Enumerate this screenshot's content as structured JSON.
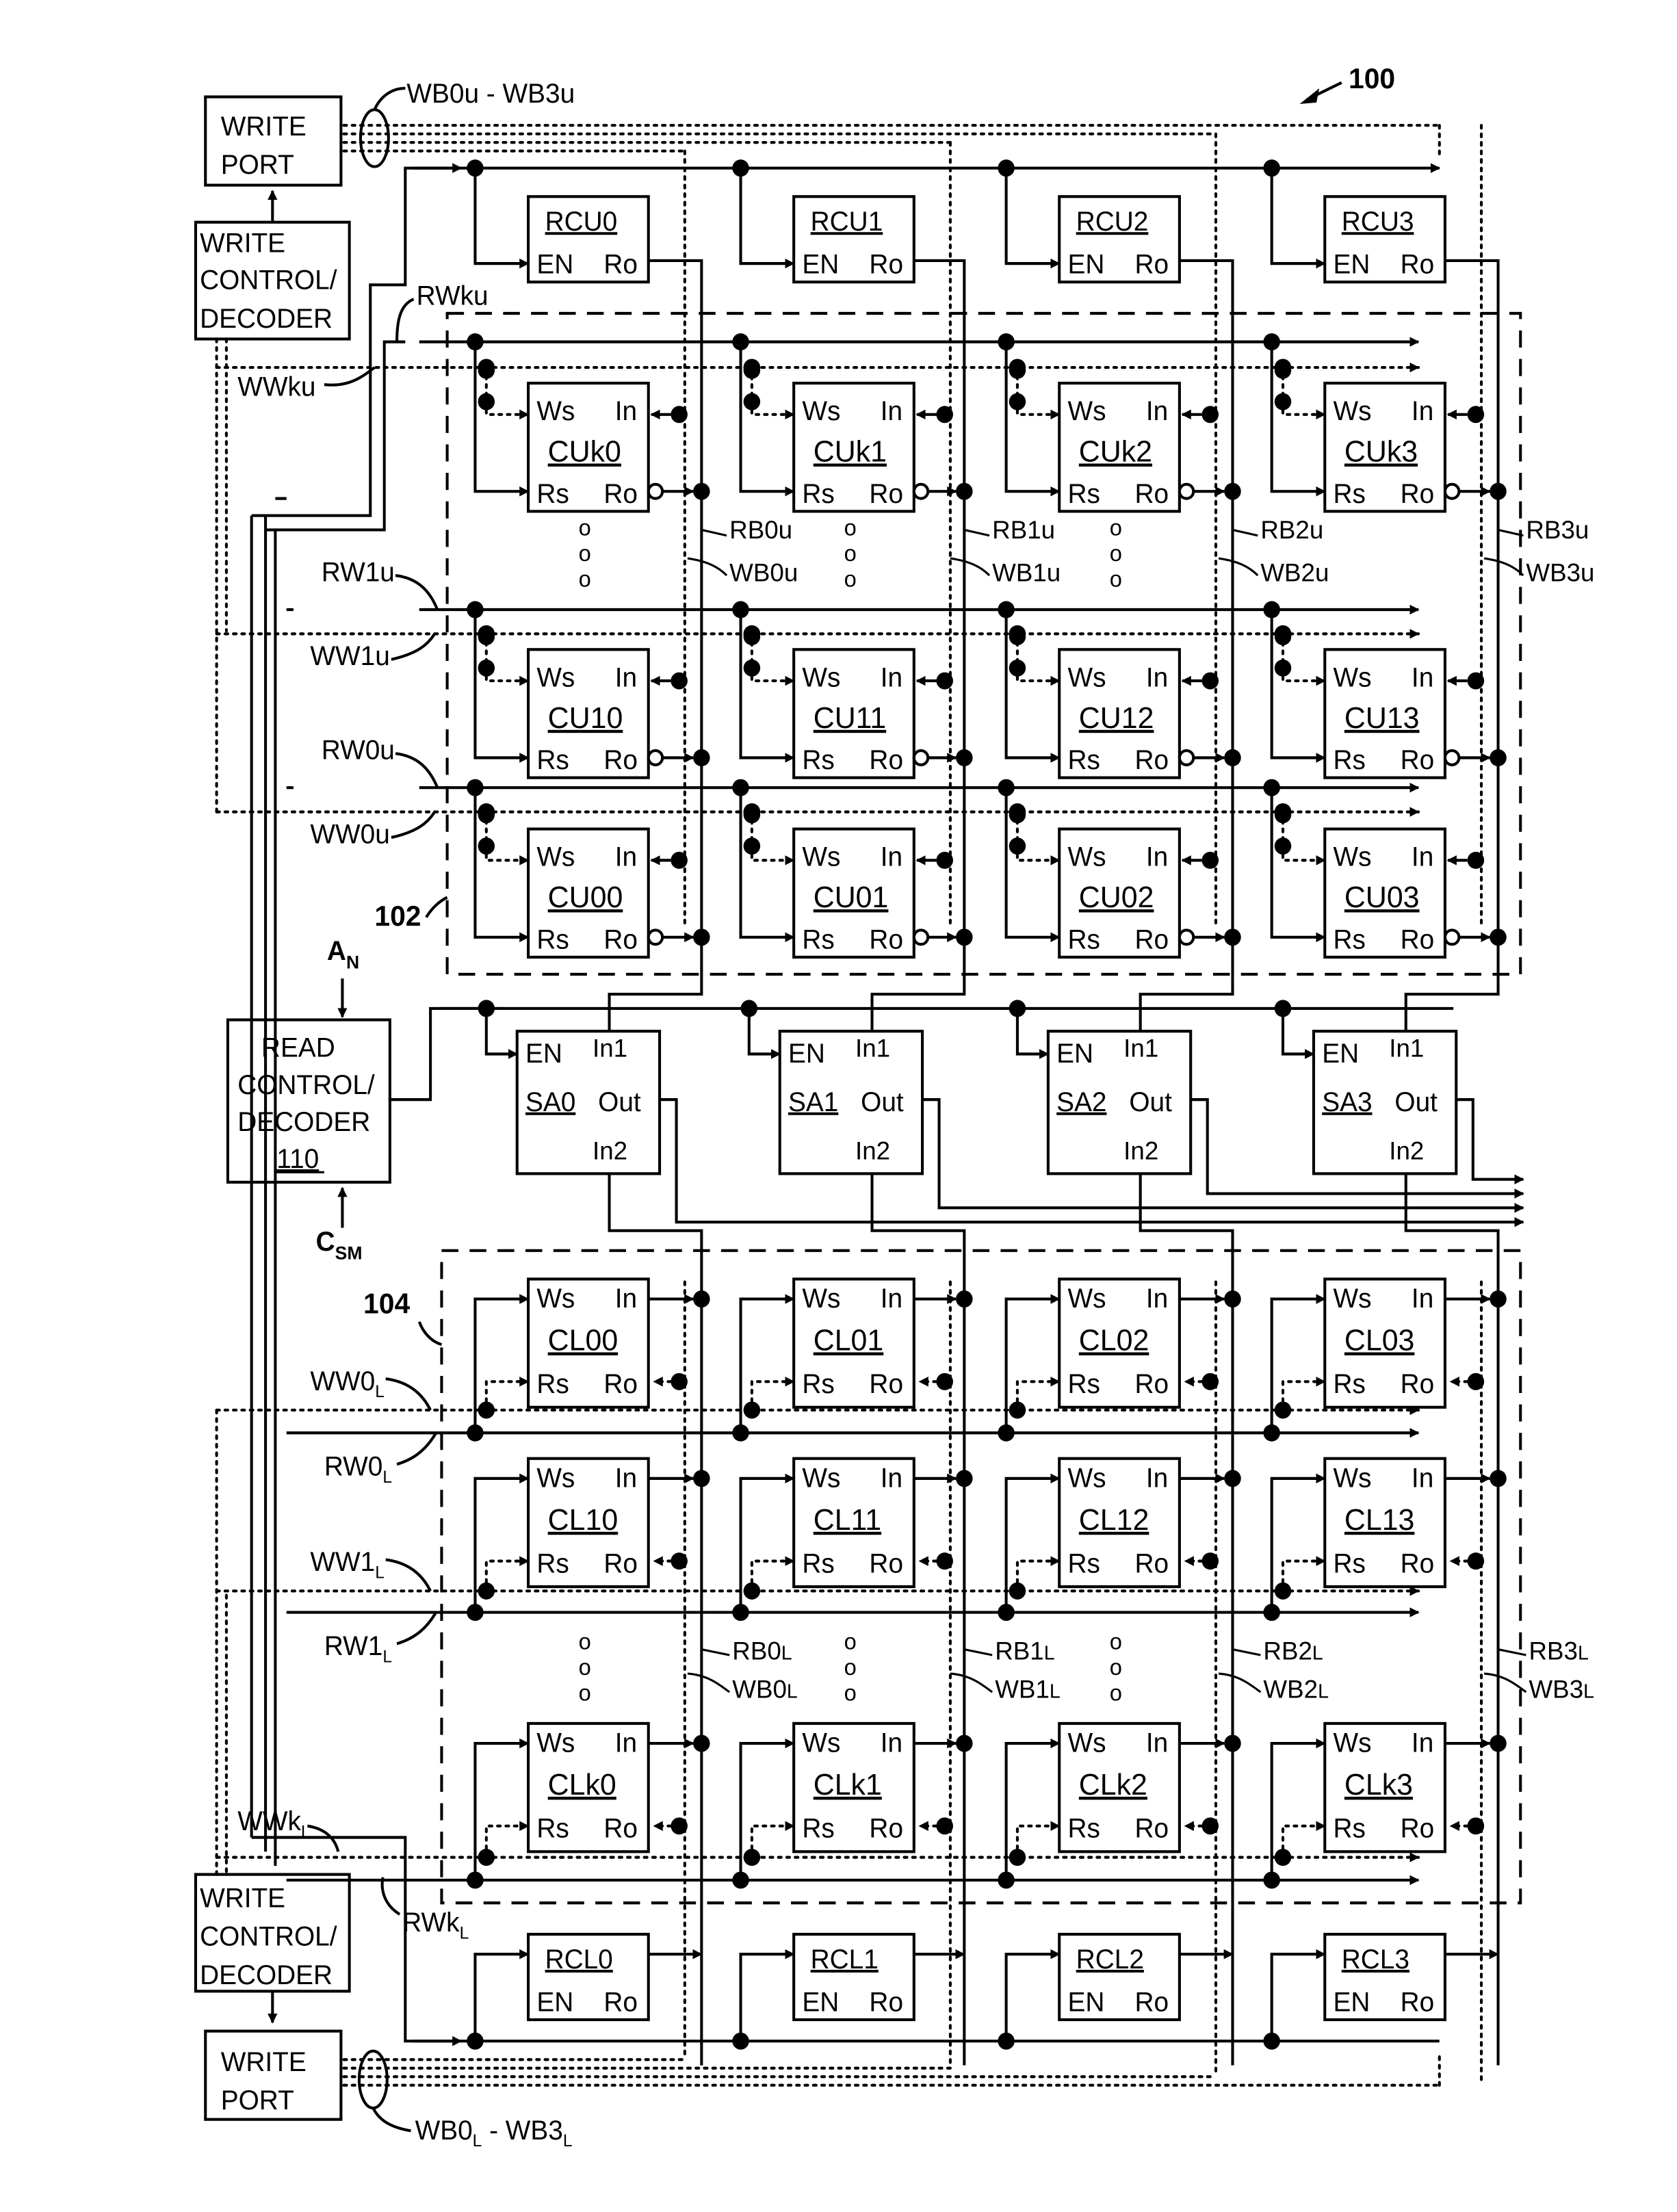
{
  "figure": {
    "ref_number": "100",
    "upper_array_ref": "102",
    "lower_array_ref": "104"
  },
  "upper_write_port": {
    "label_line1": "WRITE",
    "label_line2": "PORT",
    "bus_label": "WB0u - WB3u"
  },
  "upper_write_control": {
    "line1": "WRITE",
    "line2": "CONTROL/",
    "line3": "DECODER"
  },
  "lower_write_port": {
    "label_line1": "WRITE",
    "label_line2": "PORT",
    "bus_label_main": "WB0",
    "bus_label_sub": "L",
    "bus_label_mid": " - WB3",
    "bus_label_sub2": "L"
  },
  "lower_write_control": {
    "line1": "WRITE",
    "line2": "CONTROL/",
    "line3": "DECODER"
  },
  "read_control": {
    "line1": "READ",
    "line2": "CONTROL/",
    "line3": "DECODER",
    "ref": "110",
    "input_top": "A",
    "input_top_sub": "N",
    "input_bottom": "C",
    "input_bottom_sub": "SM"
  },
  "upper_ref_cells": [
    {
      "name": "RCU0",
      "en": "EN",
      "out": "Ro"
    },
    {
      "name": "RCU1",
      "en": "EN",
      "out": "Ro"
    },
    {
      "name": "RCU2",
      "en": "EN",
      "out": "Ro"
    },
    {
      "name": "RCU3",
      "en": "EN",
      "out": "Ro"
    }
  ],
  "lower_ref_cells": [
    {
      "name": "RCL0",
      "en": "EN",
      "out": "Ro"
    },
    {
      "name": "RCL1",
      "en": "EN",
      "out": "Ro"
    },
    {
      "name": "RCL2",
      "en": "EN",
      "out": "Ro"
    },
    {
      "name": "RCL3",
      "en": "EN",
      "out": "Ro"
    }
  ],
  "cell_pins": {
    "ws": "Ws",
    "in": "In",
    "rs": "Rs",
    "ro": "Ro"
  },
  "upper_rows": [
    {
      "cells": [
        "CUk0",
        "CUk1",
        "CUk2",
        "CUk3"
      ],
      "rw": "RWku",
      "ww": "WWku"
    },
    {
      "cells": [
        "CU10",
        "CU11",
        "CU12",
        "CU13"
      ],
      "rw": "RW1u",
      "ww": "WW1u"
    },
    {
      "cells": [
        "CU00",
        "CU01",
        "CU02",
        "CU03"
      ],
      "rw": "RW0u",
      "ww": "WW0u"
    }
  ],
  "lower_rows": [
    {
      "cells": [
        "CL00",
        "CL01",
        "CL02",
        "CL03"
      ],
      "rw_main": "RW0",
      "ww_main": "WW0"
    },
    {
      "cells": [
        "CL10",
        "CL11",
        "CL12",
        "CL13"
      ],
      "rw_main": "RW1",
      "ww_main": "WW1"
    },
    {
      "cells": [
        "CLk0",
        "CLk1",
        "CLk2",
        "CLk3"
      ],
      "rw_main": "RWk",
      "ww_main": "WWk"
    }
  ],
  "lower_sub": "L",
  "upper_bitlines": [
    {
      "rb": "RB0u",
      "wb": "WB0u"
    },
    {
      "rb": "RB1u",
      "wb": "WB1u"
    },
    {
      "rb": "RB2u",
      "wb": "WB2u"
    },
    {
      "rb": "RB3u",
      "wb": "WB3u"
    }
  ],
  "lower_bitlines": [
    {
      "rb": "RB0",
      "wb": "WB0"
    },
    {
      "rb": "RB1",
      "wb": "WB1"
    },
    {
      "rb": "RB2",
      "wb": "WB2"
    },
    {
      "rb": "RB3",
      "wb": "WB3"
    }
  ],
  "sense_amps": [
    {
      "name": "SA0",
      "en": "EN",
      "in1": "In1",
      "out": "Out",
      "in2": "In2"
    },
    {
      "name": "SA1",
      "en": "EN",
      "in1": "In1",
      "out": "Out",
      "in2": "In2"
    },
    {
      "name": "SA2",
      "en": "EN",
      "in1": "In1",
      "out": "Out",
      "in2": "In2"
    },
    {
      "name": "SA3",
      "en": "EN",
      "in1": "In1",
      "out": "Out",
      "in2": "In2"
    }
  ],
  "ellipsis_symbol": "o"
}
